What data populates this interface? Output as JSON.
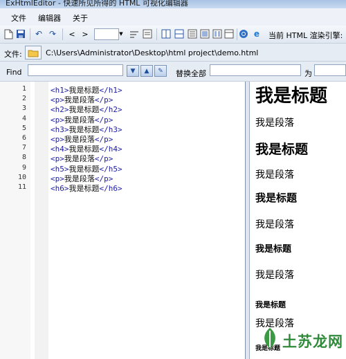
{
  "window": {
    "title": "ExHtmlEditor - 快速所见所得的 HTML 可视化编辑器"
  },
  "menu": [
    "文件",
    "编辑器",
    "关于"
  ],
  "toolbar": {
    "render_label": "当前 HTML 渲染引擎:"
  },
  "file": {
    "label": "文件:",
    "path": "C:\\Users\\Administrator\\Desktop\\html project\\demo.html"
  },
  "find": {
    "find_label": "Find",
    "find_value": "",
    "replace_all_label": "替换全部",
    "replace_value": "",
    "with_label": "为",
    "with_value": ""
  },
  "editor": {
    "line_numbers": [
      "1",
      "2",
      "3",
      "4",
      "5",
      "6",
      "7",
      "8",
      "9",
      "10",
      "11"
    ],
    "lines": [
      {
        "open": "<h1>",
        "text": "我是标题",
        "close": "</h1>"
      },
      {
        "open": "<p>",
        "text": "我是段落",
        "close": "</p>"
      },
      {
        "open": "<h2>",
        "text": "我是标题",
        "close": "</h2>"
      },
      {
        "open": "<p>",
        "text": "我是段落",
        "close": "</p>"
      },
      {
        "open": "<h3>",
        "text": "我是标题",
        "close": "</h3>"
      },
      {
        "open": "<p>",
        "text": "我是段落",
        "close": "</p>"
      },
      {
        "open": "<h4>",
        "text": "我是标题",
        "close": "</h4>"
      },
      {
        "open": "<p>",
        "text": "我是段落",
        "close": "</p>"
      },
      {
        "open": "<h5>",
        "text": "我是标题",
        "close": "</h5>"
      },
      {
        "open": "<p>",
        "text": "我是段落",
        "close": "</p>"
      },
      {
        "open": "<h6>",
        "text": "我是标题",
        "close": "</h6>"
      }
    ]
  },
  "preview": [
    {
      "text": "我是标题",
      "level": "h1"
    },
    {
      "text": "我是段落",
      "level": "p"
    },
    {
      "text": "我是标题",
      "level": "h2"
    },
    {
      "text": "我是段落",
      "level": "p"
    },
    {
      "text": "我是标题",
      "level": "h3"
    },
    {
      "text": "我是段落",
      "level": "p"
    },
    {
      "text": "我是标题",
      "level": "h4"
    },
    {
      "text": "我是段落",
      "level": "p"
    },
    {
      "text": "我是标题",
      "level": "h5"
    },
    {
      "text": "我是段落",
      "level": "p"
    },
    {
      "text": "我是标题",
      "level": "h6"
    }
  ],
  "watermark": {
    "text": "土苏龙网"
  },
  "colors": {
    "tag": "#1a1aa6",
    "accent": "#1f4f9a",
    "watermark": "#2f8a3a"
  }
}
